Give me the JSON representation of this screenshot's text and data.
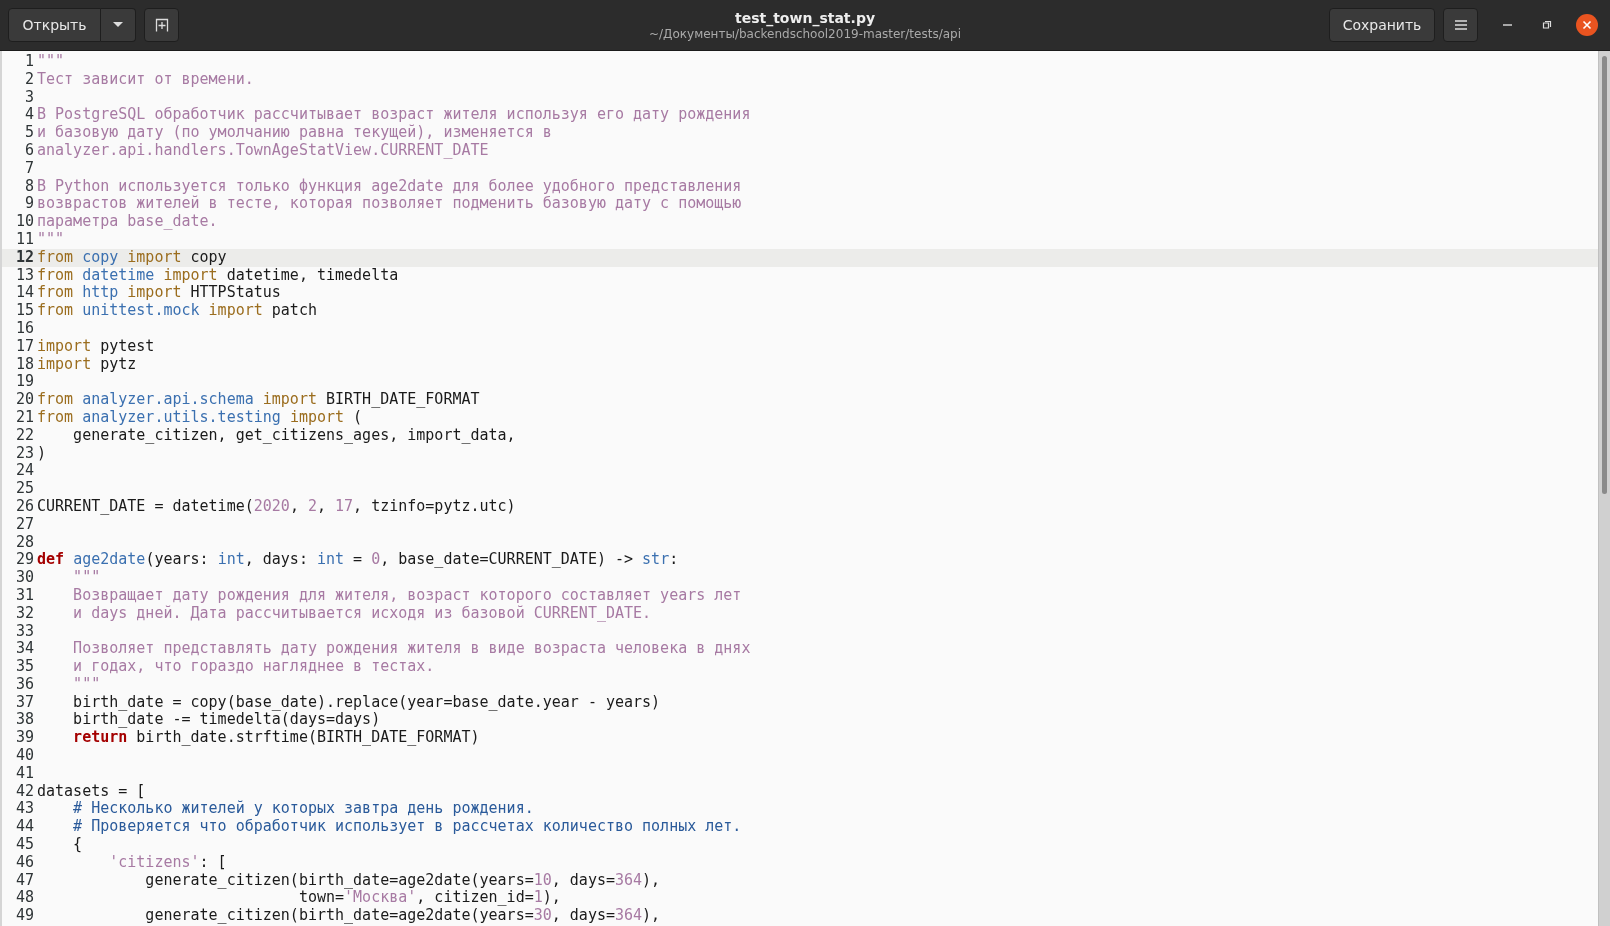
{
  "header": {
    "open_button": "Открыть",
    "title": "test_town_stat.py",
    "subtitle": "~/Документы/backendschool2019-master/tests/api",
    "save_button": "Сохранить"
  },
  "lines": [
    {
      "number": "1",
      "current": false,
      "tokens": [
        {
          "kind": "doc",
          "text": "\"\"\""
        }
      ]
    },
    {
      "number": "2",
      "current": false,
      "tokens": [
        {
          "kind": "doc",
          "text": "Тест зависит от времени."
        }
      ]
    },
    {
      "number": "3",
      "current": false
    },
    {
      "number": "4",
      "current": false,
      "tokens": [
        {
          "kind": "doc",
          "text": "В PostgreSQL обработчик рассчитывает возраст жителя используя его дату рождения"
        }
      ]
    },
    {
      "number": "5",
      "current": false,
      "tokens": [
        {
          "kind": "doc",
          "text": "и базовую дату (по умолчанию равна текущей), изменяется в"
        }
      ]
    },
    {
      "number": "6",
      "current": false,
      "tokens": [
        {
          "kind": "doc",
          "text": "analyzer.api.handlers.TownAgeStatView.CURRENT_DATE"
        }
      ]
    },
    {
      "number": "7",
      "current": false
    },
    {
      "number": "8",
      "current": false,
      "tokens": [
        {
          "kind": "doc",
          "text": "В Python используется только функция age2date для более удобного представления"
        }
      ]
    },
    {
      "number": "9",
      "current": false,
      "tokens": [
        {
          "kind": "doc",
          "text": "возврастов жителей в тесте, которая позволяет подменить базовую дату с помощью"
        }
      ]
    },
    {
      "number": "10",
      "current": false,
      "tokens": [
        {
          "kind": "doc",
          "text": "параметра base_date."
        }
      ]
    },
    {
      "number": "11",
      "current": false,
      "tokens": [
        {
          "kind": "doc",
          "text": "\"\"\""
        }
      ]
    },
    {
      "number": "12",
      "current": true,
      "tokens": [
        {
          "kind": "kw",
          "text": "from "
        },
        {
          "kind": "mod",
          "text": "copy "
        },
        {
          "kind": "kw",
          "text": "import"
        },
        {
          "kind": "t",
          "text": " copy"
        }
      ]
    },
    {
      "number": "13",
      "current": false,
      "tokens": [
        {
          "kind": "kw",
          "text": "from "
        },
        {
          "kind": "mod",
          "text": "datetime "
        },
        {
          "kind": "kw",
          "text": "import"
        },
        {
          "kind": "t",
          "text": " datetime, timedelta"
        }
      ]
    },
    {
      "number": "14",
      "current": false,
      "tokens": [
        {
          "kind": "kw",
          "text": "from "
        },
        {
          "kind": "mod",
          "text": "http "
        },
        {
          "kind": "kw",
          "text": "import"
        },
        {
          "kind": "t",
          "text": " HTTPStatus"
        }
      ]
    },
    {
      "number": "15",
      "current": false,
      "tokens": [
        {
          "kind": "kw",
          "text": "from "
        },
        {
          "kind": "mod",
          "text": "unittest.mock "
        },
        {
          "kind": "kw",
          "text": "import"
        },
        {
          "kind": "t",
          "text": " patch"
        }
      ]
    },
    {
      "number": "16",
      "current": false
    },
    {
      "number": "17",
      "current": false,
      "tokens": [
        {
          "kind": "kw",
          "text": "import"
        },
        {
          "kind": "t",
          "text": " pytest"
        }
      ]
    },
    {
      "number": "18",
      "current": false,
      "tokens": [
        {
          "kind": "kw",
          "text": "import"
        },
        {
          "kind": "t",
          "text": " pytz"
        }
      ]
    },
    {
      "number": "19",
      "current": false
    },
    {
      "number": "20",
      "current": false,
      "tokens": [
        {
          "kind": "kw",
          "text": "from "
        },
        {
          "kind": "mod",
          "text": "analyzer.api.schema "
        },
        {
          "kind": "kw",
          "text": "import"
        },
        {
          "kind": "t",
          "text": " BIRTH_DATE_FORMAT"
        }
      ]
    },
    {
      "number": "21",
      "current": false,
      "tokens": [
        {
          "kind": "kw",
          "text": "from "
        },
        {
          "kind": "mod",
          "text": "analyzer.utils.testing "
        },
        {
          "kind": "kw",
          "text": "import"
        },
        {
          "kind": "t",
          "text": " ("
        }
      ]
    },
    {
      "number": "22",
      "current": false,
      "tokens": [
        {
          "kind": "t",
          "text": "    generate_citizen, get_citizens_ages, import_data,"
        }
      ]
    },
    {
      "number": "23",
      "current": false,
      "tokens": [
        {
          "kind": "t",
          "text": ")"
        }
      ]
    },
    {
      "number": "24",
      "current": false
    },
    {
      "number": "25",
      "current": false
    },
    {
      "number": "26",
      "current": false,
      "tokens": [
        {
          "kind": "t",
          "text": "CURRENT_DATE = datetime("
        },
        {
          "kind": "num",
          "text": "2020"
        },
        {
          "kind": "t",
          "text": ", "
        },
        {
          "kind": "num",
          "text": "2"
        },
        {
          "kind": "t",
          "text": ", "
        },
        {
          "kind": "num",
          "text": "17"
        },
        {
          "kind": "t",
          "text": ", tzinfo=pytz.utc)"
        }
      ]
    },
    {
      "number": "27",
      "current": false
    },
    {
      "number": "28",
      "current": false
    },
    {
      "number": "29",
      "current": false,
      "tokens": [
        {
          "kind": "def",
          "text": "def "
        },
        {
          "kind": "fn",
          "text": "age2date"
        },
        {
          "kind": "t",
          "text": "(years: "
        },
        {
          "kind": "type",
          "text": "int"
        },
        {
          "kind": "t",
          "text": ", days: "
        },
        {
          "kind": "type",
          "text": "int"
        },
        {
          "kind": "t",
          "text": " = "
        },
        {
          "kind": "num",
          "text": "0"
        },
        {
          "kind": "t",
          "text": ", base_date=CURRENT_DATE) -> "
        },
        {
          "kind": "type",
          "text": "str"
        },
        {
          "kind": "t",
          "text": ":"
        }
      ]
    },
    {
      "number": "30",
      "current": false,
      "tokens": [
        {
          "kind": "doc",
          "text": "    \"\"\""
        }
      ]
    },
    {
      "number": "31",
      "current": false,
      "tokens": [
        {
          "kind": "doc",
          "text": "    Возвращает дату рождения для жителя, возраст которого составляет years лет"
        }
      ]
    },
    {
      "number": "32",
      "current": false,
      "tokens": [
        {
          "kind": "doc",
          "text": "    и days дней. Дата рассчитывается исходя из базовой CURRENT_DATE."
        }
      ]
    },
    {
      "number": "33",
      "current": false
    },
    {
      "number": "34",
      "current": false,
      "tokens": [
        {
          "kind": "doc",
          "text": "    Позволяет представлять дату рождения жителя в виде возраста человека в днях"
        }
      ]
    },
    {
      "number": "35",
      "current": false,
      "tokens": [
        {
          "kind": "doc",
          "text": "    и годах, что гораздо нагляднее в тестах."
        }
      ]
    },
    {
      "number": "36",
      "current": false,
      "tokens": [
        {
          "kind": "doc",
          "text": "    \"\"\""
        }
      ]
    },
    {
      "number": "37",
      "current": false,
      "tokens": [
        {
          "kind": "t",
          "text": "    birth_date = copy(base_date).replace(year=base_date.year - years)"
        }
      ]
    },
    {
      "number": "38",
      "current": false,
      "tokens": [
        {
          "kind": "t",
          "text": "    birth_date -= timedelta(days=days)"
        }
      ]
    },
    {
      "number": "39",
      "current": false,
      "tokens": [
        {
          "kind": "def",
          "text": "    return"
        },
        {
          "kind": "t",
          "text": " birth_date.strftime(BIRTH_DATE_FORMAT)"
        }
      ]
    },
    {
      "number": "40",
      "current": false
    },
    {
      "number": "41",
      "current": false
    },
    {
      "number": "42",
      "current": false,
      "tokens": [
        {
          "kind": "t",
          "text": "datasets = ["
        }
      ]
    },
    {
      "number": "43",
      "current": false,
      "tokens": [
        {
          "kind": "cm",
          "text": "    # Несколько жителей у которых завтра день рождения."
        }
      ]
    },
    {
      "number": "44",
      "current": false,
      "tokens": [
        {
          "kind": "cm",
          "text": "    # Проверяется что обработчик использует в рассчетах количество полных лет."
        }
      ]
    },
    {
      "number": "45",
      "current": false,
      "tokens": [
        {
          "kind": "t",
          "text": "    {"
        }
      ]
    },
    {
      "number": "46",
      "current": false,
      "tokens": [
        {
          "kind": "str",
          "text": "        'citizens'"
        },
        {
          "kind": "t",
          "text": ": ["
        }
      ]
    },
    {
      "number": "47",
      "current": false,
      "tokens": [
        {
          "kind": "t",
          "text": "            generate_citizen(birth_date=age2date(years="
        },
        {
          "kind": "num",
          "text": "10"
        },
        {
          "kind": "t",
          "text": ", days="
        },
        {
          "kind": "num",
          "text": "364"
        },
        {
          "kind": "t",
          "text": "),"
        }
      ]
    },
    {
      "number": "48",
      "current": false,
      "tokens": [
        {
          "kind": "t",
          "text": "                             town="
        },
        {
          "kind": "str",
          "text": "'Москва'"
        },
        {
          "kind": "t",
          "text": ", citizen_id="
        },
        {
          "kind": "num",
          "text": "1"
        },
        {
          "kind": "t",
          "text": "),"
        }
      ]
    },
    {
      "number": "49",
      "current": false,
      "tokens": [
        {
          "kind": "t",
          "text": "            generate_citizen(birth_date=age2date(years="
        },
        {
          "kind": "num",
          "text": "30"
        },
        {
          "kind": "t",
          "text": ", days="
        },
        {
          "kind": "num",
          "text": "364"
        },
        {
          "kind": "t",
          "text": "),"
        }
      ]
    }
  ]
}
